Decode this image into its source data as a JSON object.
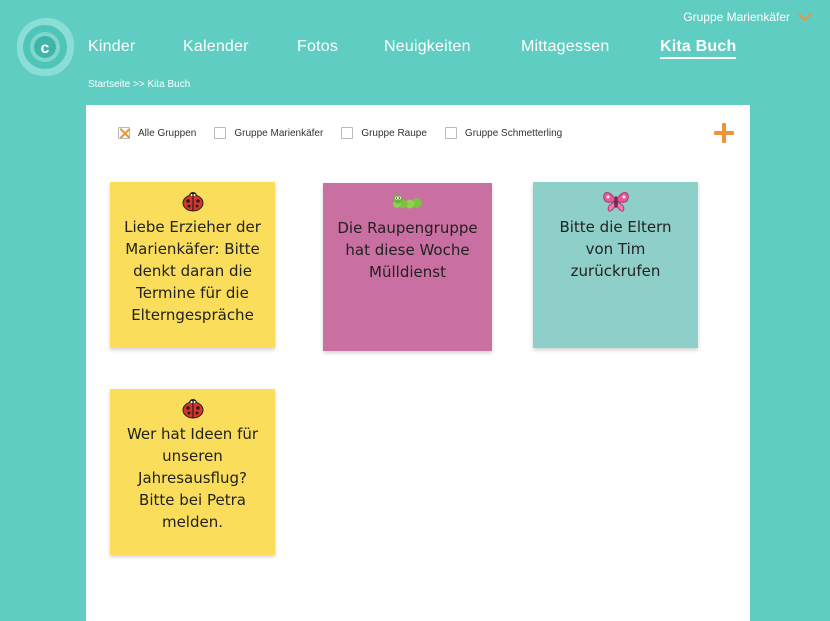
{
  "header": {
    "group_select": "Gruppe Marienkäfer",
    "nav": [
      {
        "label": "Kinder"
      },
      {
        "label": "Kalender"
      },
      {
        "label": "Fotos"
      },
      {
        "label": "Neuigkeiten"
      },
      {
        "label": "Mittagessen"
      },
      {
        "label": "Kita Buch",
        "active": true
      }
    ],
    "breadcrumb": "Startseite >> Kita Buch"
  },
  "filters": [
    {
      "label": "Alle Gruppen",
      "checked": true
    },
    {
      "label": "Gruppe Marienkäfer",
      "checked": false
    },
    {
      "label": "Gruppe Raupe",
      "checked": false
    },
    {
      "label": "Gruppe Schmetterling",
      "checked": false
    }
  ],
  "notes": [
    {
      "icon": "ladybug-icon",
      "color": "#f9dd5b",
      "text": "Liebe Erzieher der Marienkäfer: Bitte denkt daran die Termine für die Elterngespräche"
    },
    {
      "icon": "caterpillar-icon",
      "color": "#c96fa1",
      "text": "Die Raupengruppe hat diese Woche Mülldienst"
    },
    {
      "icon": "butterfly-icon",
      "color": "#8fcfc9",
      "text": "Bitte die Eltern von Tim zurückrufen"
    },
    {
      "icon": "ladybug-icon",
      "color": "#f9dd5b",
      "text": "Wer hat Ideen für unseren Jahresausflug? Bitte bei Petra melden."
    }
  ],
  "colors": {
    "background": "#5fcdc2",
    "accent": "#f0923a"
  }
}
